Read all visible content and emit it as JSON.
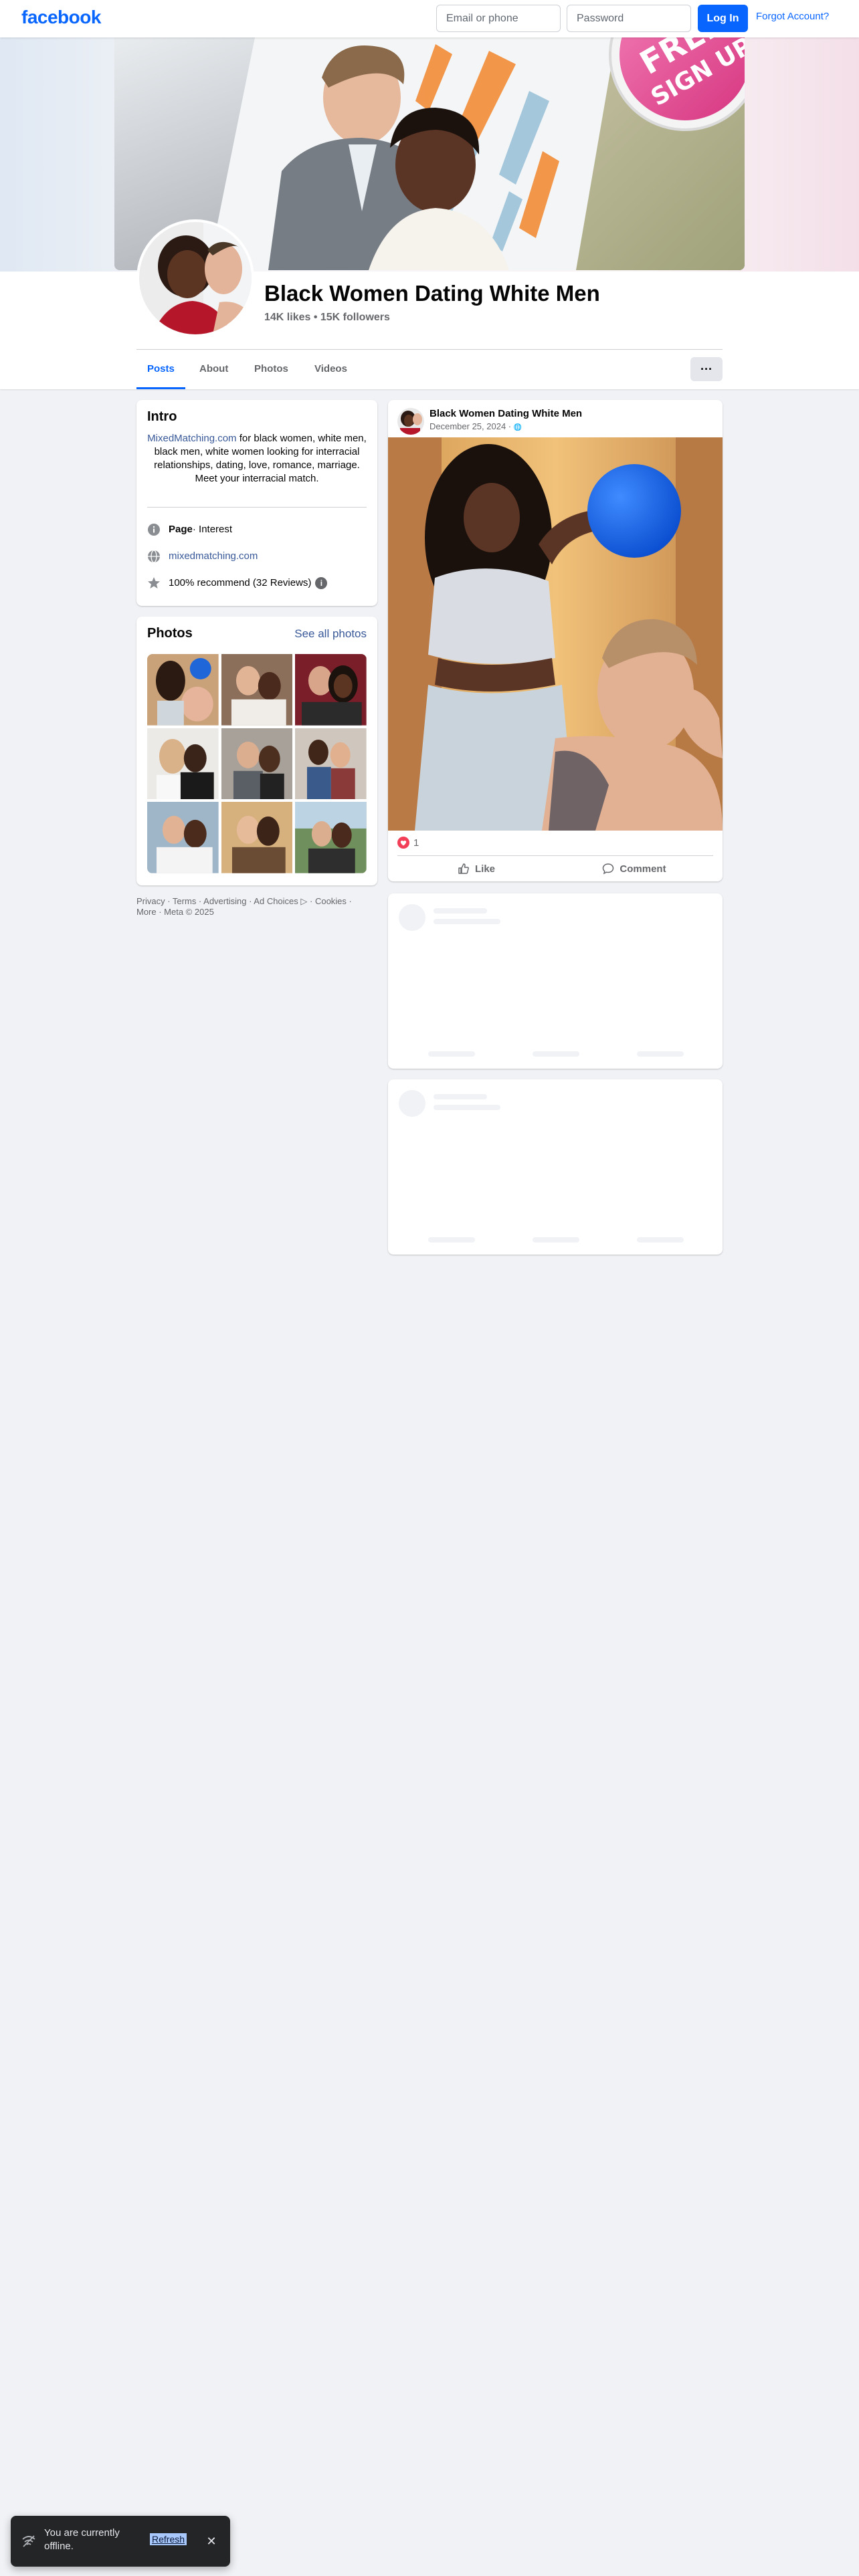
{
  "topbar": {
    "logo": "facebook",
    "email_placeholder": "Email or phone",
    "password_placeholder": "Password",
    "login_label": "Log In",
    "forgot_label": "Forgot Account?"
  },
  "cover": {
    "badge_line1": "FREE",
    "badge_line2": "SIGN UP"
  },
  "profile": {
    "name": "Black Women Dating White Men",
    "stats": "14K likes • 15K followers"
  },
  "tabs": [
    {
      "label": "Posts",
      "active": true
    },
    {
      "label": "About",
      "active": false
    },
    {
      "label": "Photos",
      "active": false
    },
    {
      "label": "Videos",
      "active": false
    }
  ],
  "more_label": "···",
  "intro": {
    "title": "Intro",
    "desc_link": "MixedMatching.com",
    "desc_rest": " for black women, white men, black men, white women looking for interracial relationships, dating, love, romance, marriage. Meet your interracial match.",
    "category_bold": "Page",
    "category_rest": " · Interest",
    "website": "mixedmatching.com",
    "recommend": "100% recommend (32 Reviews)",
    "info_glyph": "i"
  },
  "photos": {
    "title": "Photos",
    "see_all": "See all photos"
  },
  "footer": {
    "line1": "Privacy · Terms · Advertising · Ad Choices ▷ · Cookies ·",
    "line2": "More · Meta © 2025"
  },
  "post": {
    "author": "Black Women Dating White Men",
    "date": "December 25, 2024 · ",
    "globe": "🌐",
    "reaction_count": "1",
    "like_label": "Like",
    "comment_label": "Comment"
  },
  "toast": {
    "text": "You are currently offline.",
    "refresh": "Refresh",
    "close": "✕"
  },
  "colors": {
    "brand_blue": "#0866ff",
    "link_blue": "#385898",
    "background": "#f0f2f5"
  }
}
